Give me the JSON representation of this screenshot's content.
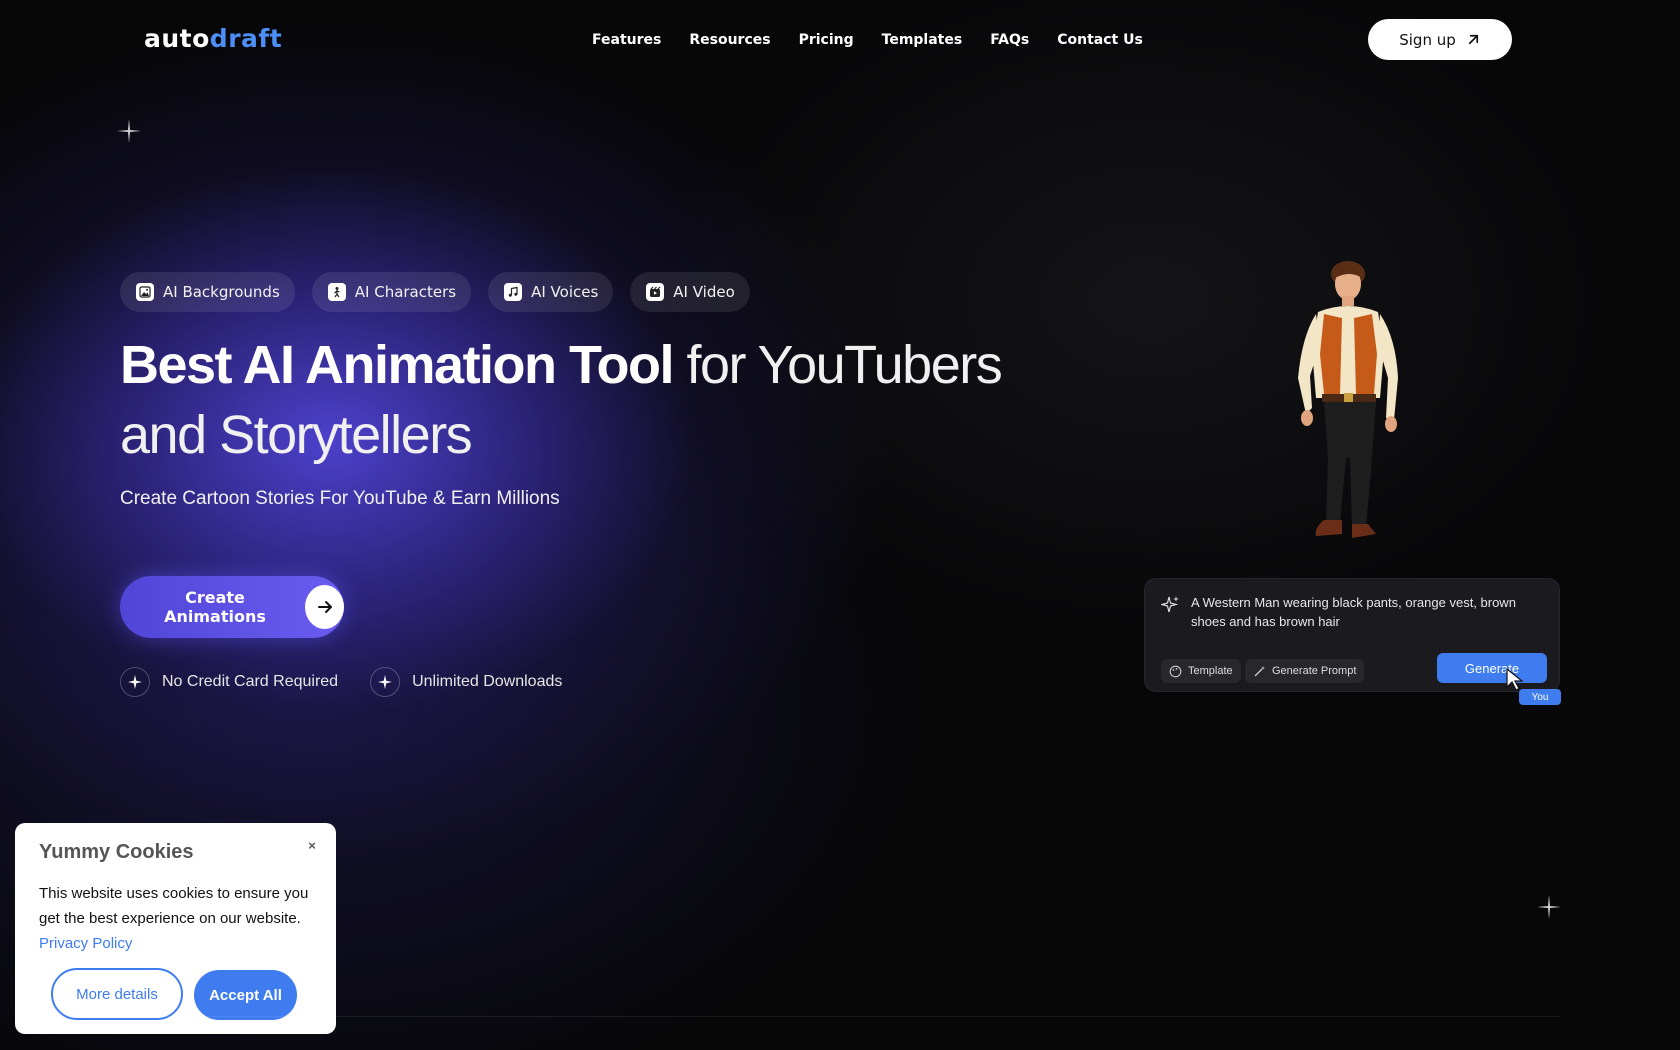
{
  "logo": {
    "part1": "auto",
    "part2": "draft"
  },
  "nav": {
    "items": [
      "Features",
      "Resources",
      "Pricing",
      "Templates",
      "FAQs",
      "Contact Us"
    ],
    "signup_label": "Sign up"
  },
  "tags": [
    {
      "label": "AI Backgrounds",
      "icon": "image-icon"
    },
    {
      "label": "AI Characters",
      "icon": "person-icon"
    },
    {
      "label": "AI Voices",
      "icon": "music-icon"
    },
    {
      "label": "AI Video",
      "icon": "video-icon"
    }
  ],
  "hero": {
    "headline_bold": "Best AI Animation Tool",
    "headline_light": " for YouTubers and Storytellers",
    "subheadline": "Create Cartoon Stories For YouTube & Earn Millions",
    "cta_label": "Create Animations",
    "features": [
      "No Credit Card Required",
      "Unlimited Downloads"
    ]
  },
  "prompt_card": {
    "text": "A Western Man wearing black pants, orange vest, brown shoes and has brown hair",
    "template_label": "Template",
    "generate_prompt_label": "Generate Prompt",
    "generate_label": "Generate",
    "you_label": "You"
  },
  "cookie": {
    "title": "Yummy Cookies",
    "close_label": "×",
    "body": "This website uses cookies to ensure you get the best experience on our website.",
    "link": "Privacy Policy",
    "more_label": "More details",
    "accept_label": "Accept All"
  },
  "colors": {
    "accent": "#3e7cf0",
    "logo_accent": "#4b8ff7",
    "cta": "#5a4de0",
    "background": "#070708"
  }
}
